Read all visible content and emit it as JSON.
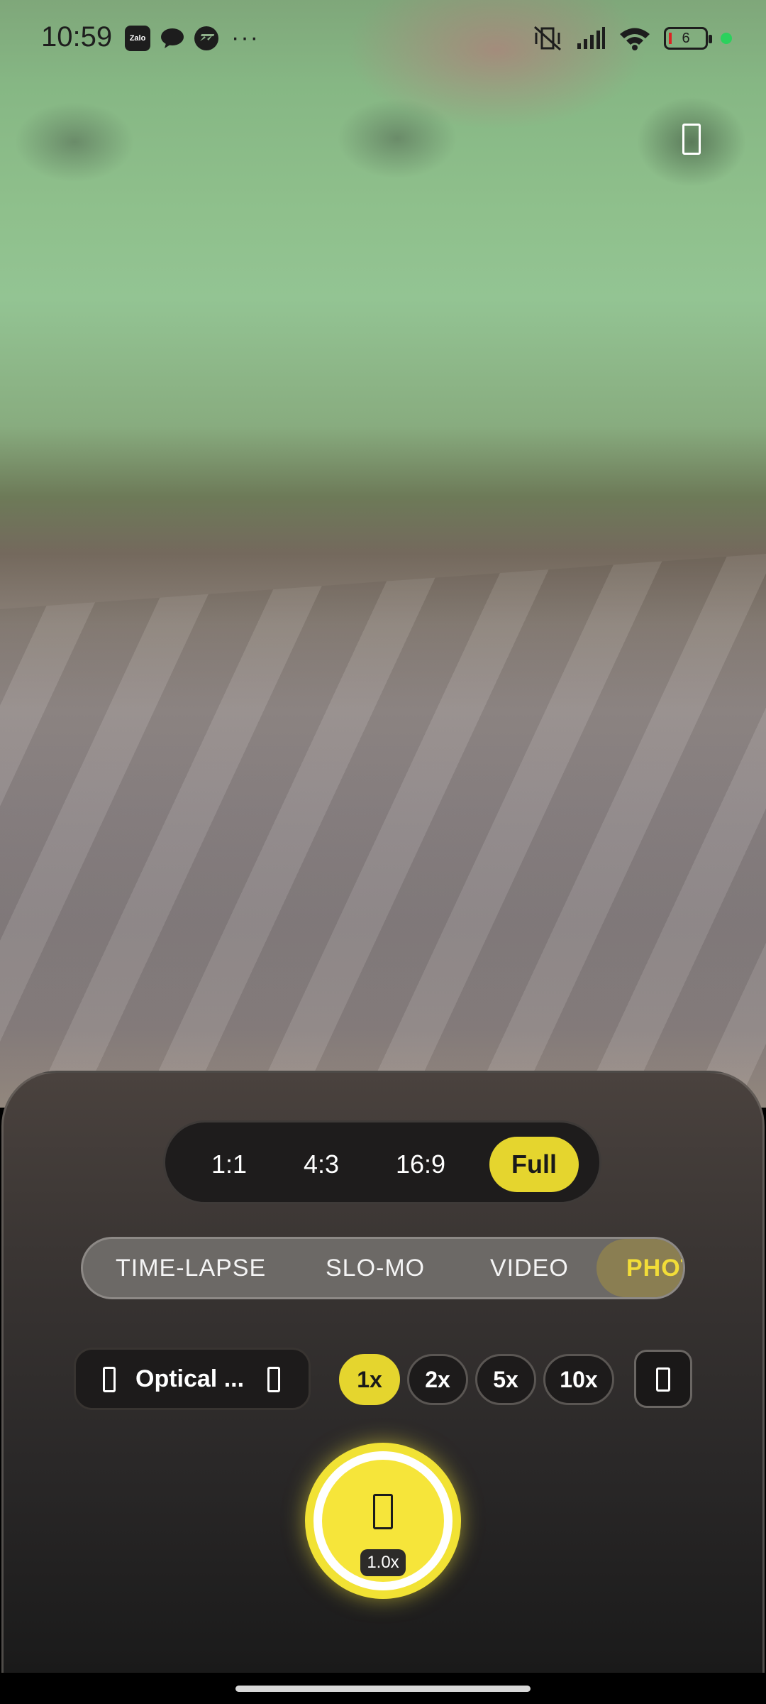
{
  "status_bar": {
    "time": "10:59",
    "app_icons": [
      "zalo-icon",
      "chat-bubble-icon",
      "messenger-icon"
    ],
    "zalo_label": "Zalo",
    "more_label": "···",
    "battery_level": "6",
    "icons": [
      "vibrate-mute-icon",
      "signal-icon",
      "wifi-icon",
      "battery-icon",
      "privacy-dot-icon"
    ],
    "privacy_dot_color": "#2bd15d"
  },
  "viewfinder": {
    "corner_icon": "rectangle-icon"
  },
  "aspect_ratio": {
    "options": [
      "1:1",
      "4:3",
      "16:9",
      "Full"
    ],
    "selected": "Full"
  },
  "modes": {
    "items": [
      "TIME-LAPSE",
      "SLO-MO",
      "VIDEO",
      "PHOT"
    ],
    "selected": "PHOT"
  },
  "zoom_row": {
    "optical_label": "Optical ...",
    "zoom_levels": [
      "1x",
      "2x",
      "5x",
      "10x"
    ],
    "selected_zoom": "1x"
  },
  "shutter": {
    "zoom_readout": "1.0x"
  },
  "colors": {
    "accent": "#e5d52e",
    "panel": "#2a2828"
  }
}
